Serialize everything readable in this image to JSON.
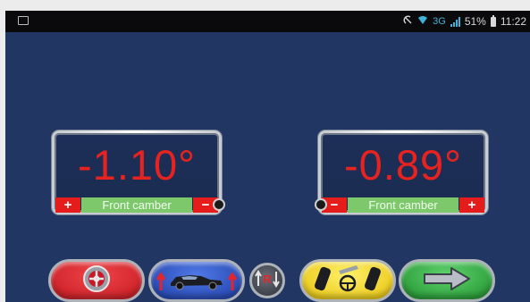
{
  "status_bar": {
    "network": "3G",
    "battery": "51%",
    "time": "11:22"
  },
  "gauges": [
    {
      "value": "-1.10°",
      "label": "Front camber",
      "plus": "+",
      "minus": "−"
    },
    {
      "value": "-0.89°",
      "label": "Front camber",
      "plus": "+",
      "minus": "−"
    }
  ],
  "colors": {
    "background": "#213663",
    "value_red": "#e8231f",
    "label_green": "#7cc86b",
    "button_red": "#e51c1c",
    "toolbar_red": "#d8202a",
    "toolbar_blue": "#2a4fc0",
    "toolbar_yellow": "#f2d21b",
    "toolbar_green": "#2fa33e"
  },
  "toolbar": {
    "icons": [
      "steering-wheel-icon",
      "car-lift-icon",
      "rear-toggle-icon",
      "steering-lock-icon",
      "next-arrow-icon"
    ]
  }
}
